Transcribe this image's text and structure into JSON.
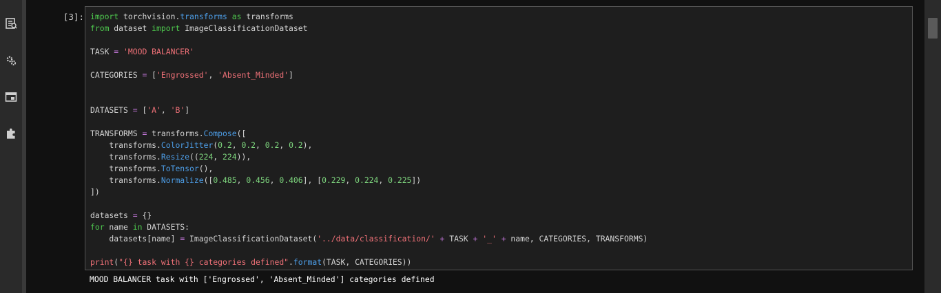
{
  "sidebar": {
    "icons": [
      "file-browser-icon",
      "running-kernels-icon",
      "tabs-icon",
      "extensions-icon"
    ]
  },
  "cell": {
    "prompt": "[3]:",
    "code_lines": [
      "import torchvision.transforms as transforms",
      "from dataset import ImageClassificationDataset",
      "",
      "TASK = 'MOOD BALANCER'",
      "",
      "CATEGORIES = ['Engrossed', 'Absent_Minded']",
      "",
      "",
      "DATASETS = ['A', 'B']",
      "",
      "TRANSFORMS = transforms.Compose([",
      "    transforms.ColorJitter(0.2, 0.2, 0.2, 0.2),",
      "    transforms.Resize((224, 224)),",
      "    transforms.ToTensor(),",
      "    transforms.Normalize([0.485, 0.456, 0.406], [0.229, 0.224, 0.225])",
      "])",
      "",
      "datasets = {}",
      "for name in DATASETS:",
      "    datasets[name] = ImageClassificationDataset('../data/classification/' + TASK + '_' + name, CATEGORIES, TRANSFORMS)",
      "",
      "print(\"{} task with {} categories defined\".format(TASK, CATEGORIES))"
    ],
    "output": "MOOD BALANCER task with ['Engrossed', 'Absent_Minded'] categories defined"
  },
  "colors": {
    "background": "#111111",
    "sidebar": "#2a2a2a",
    "editor_background": "#1e1e1e",
    "keyword": "#4ec94e",
    "string": "#f07178",
    "number": "#7fd87f",
    "function": "#4d9ee8",
    "operator": "#c678dd"
  }
}
